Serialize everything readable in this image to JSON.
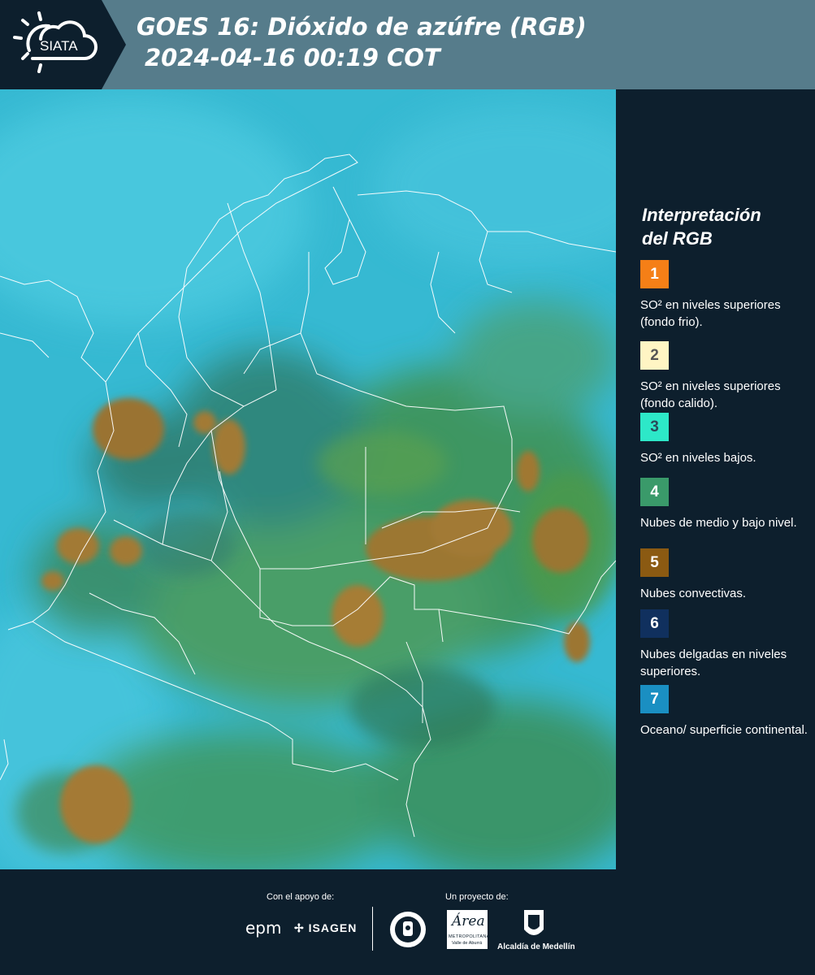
{
  "header": {
    "logo_text": "SIATA",
    "title_line1": "GOES 16: Dióxido de azúfre (RGB)",
    "title_line2": "2024-04-16 00:19 COT"
  },
  "legend": {
    "title": "Interpretación\ndel RGB",
    "items": [
      {
        "number": "1",
        "label": "SO² en niveles superiores (fondo frio).",
        "color": "#f57f17",
        "number_color": "#ffffff"
      },
      {
        "number": "2",
        "label": "SO² en niveles superiores (fondo calido).",
        "color": "#fff5c4",
        "number_color": "#555555"
      },
      {
        "number": "3",
        "label": "SO² en niveles bajos.",
        "color": "#2de8c8",
        "number_color": "#2a4a5a"
      },
      {
        "number": "4",
        "label": "Nubes de medio y bajo nivel.",
        "color": "#3a9a6a",
        "number_color": "#ffffff"
      },
      {
        "number": "5",
        "label": "Nubes convectivas.",
        "color": "#8b5a12",
        "number_color": "#ffffff"
      },
      {
        "number": "6",
        "label": "Nubes delgadas en niveles superiores.",
        "color": "#10305e",
        "number_color": "#ffffff"
      },
      {
        "number": "7",
        "label": "Oceano/ superficie continental.",
        "color": "#1a8fc2",
        "number_color": "#ffffff"
      }
    ]
  },
  "footer": {
    "support_caption": "Con el apoyo de:",
    "project_caption": "Un proyecto de:",
    "epm_text": "epm",
    "isagen_text": "ISAGEN",
    "area_text": "Área",
    "area_subtext": "METROPOLITANA",
    "area_subtext2": "Valle de Aburrá",
    "alcaldia_text": "Alcaldía de Medellín"
  },
  "colors": {
    "background": "#0d1f2d",
    "header": "#567c8b",
    "ocean": "#35b8cf",
    "green_cloud": "#3f9a5a",
    "convective_cloud": "#a07a36",
    "borders": "#ffffff"
  }
}
